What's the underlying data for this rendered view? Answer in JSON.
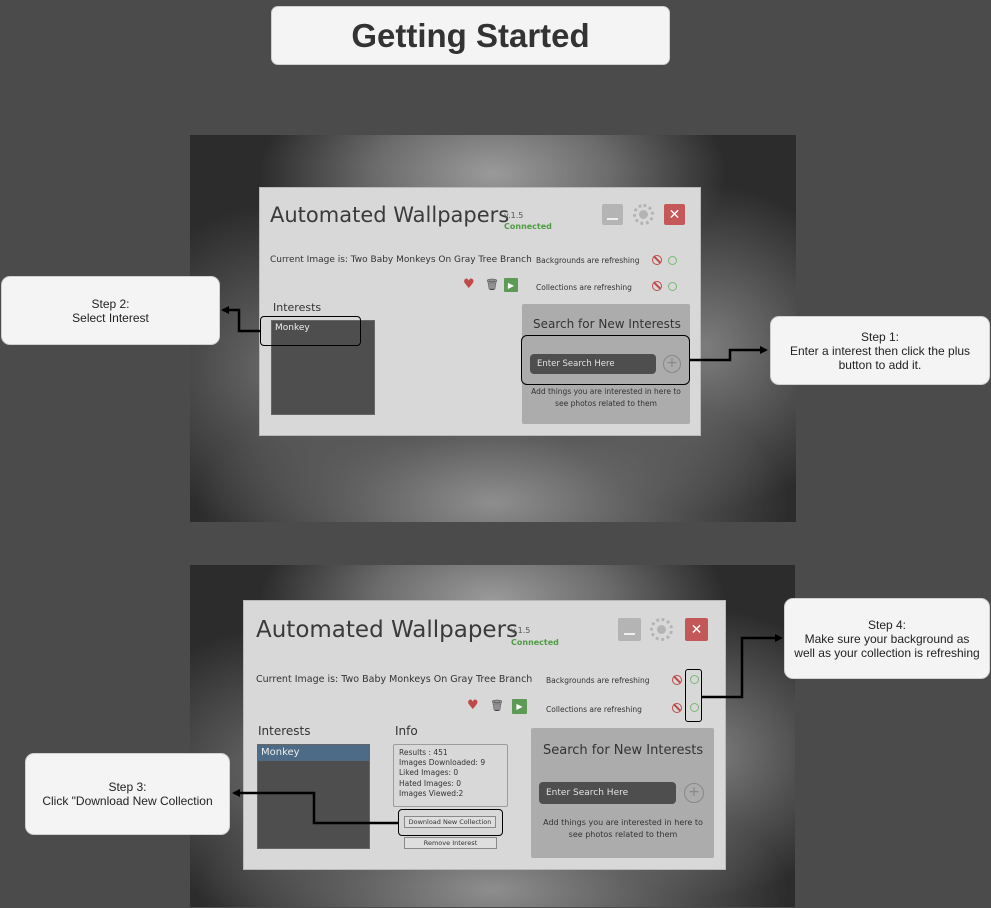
{
  "page_title": "Getting Started",
  "app": {
    "title": "Automated Wallpapers",
    "version": "v.1.5",
    "status": "Connected",
    "current_image": "Current Image is: Two Baby Monkeys On Gray Tree Branch",
    "backgrounds_status": "Backgrounds are refreshing",
    "collections_status": "Collections are refreshing",
    "interests_label": "Interests",
    "interests": [
      "Monkey"
    ],
    "info_label": "Info",
    "info_lines": [
      "Results : 451",
      "Images Downloaded: 9",
      "Liked Images: 0",
      "Hated Images: 0",
      "Images Viewed:2"
    ],
    "download_button": "Download New Collection",
    "remove_button": "Remove Interest",
    "search": {
      "title": "Search for New Interests",
      "placeholder": "Enter Search Here",
      "hint": "Add things you are interested in here to see photos related to them"
    },
    "icons": {
      "minimize": "minimize-icon",
      "settings": "gear-icon",
      "close": "close-icon",
      "like": "heart-icon",
      "delete": "trash-icon",
      "play": "play-icon",
      "blocked": "no-entry-icon",
      "ok": "circle-icon",
      "add": "plus-circle-icon"
    }
  },
  "callouts": {
    "step1_title": "Step 1:",
    "step1_text": "Enter a interest then click the plus button to add it.",
    "step2_title": "Step 2:",
    "step2_text": "Select Interest",
    "step3_title": "Step 3:",
    "step3_text": "Click \"Download New Collection",
    "step4_title": "Step 4:",
    "step4_text": "Make sure your background as well as your collection is refreshing"
  },
  "colors": {
    "background": "#4b4b4b",
    "app_bg": "#d8d8d8",
    "accent_green": "#4f9c43",
    "close_red": "#c45858",
    "selected_item": "#4d6a86"
  }
}
